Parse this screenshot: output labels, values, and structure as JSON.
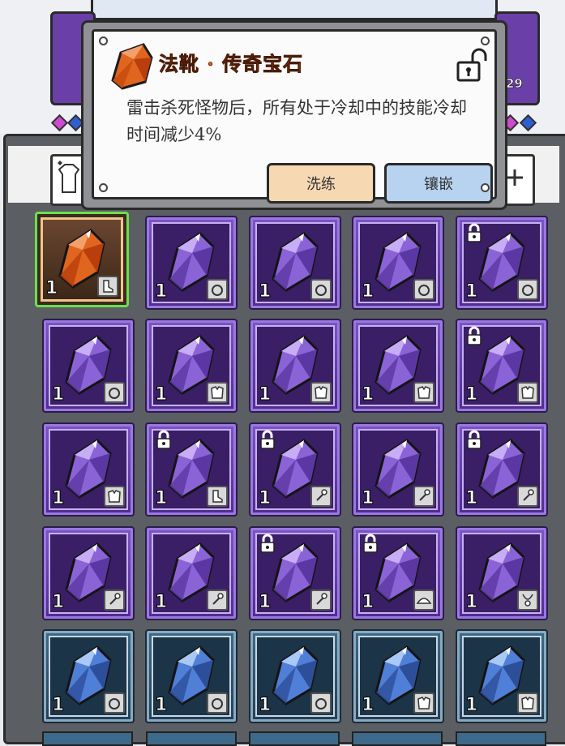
{
  "tooltip": {
    "title": "法靴 · 传奇宝石",
    "description": "雷击杀死怪物后，所有处于冷却中的技能冷却时间减少4%",
    "buttons": {
      "wash": "洗练",
      "inlay": "镶嵌"
    },
    "locked": false
  },
  "header": {
    "timer_fragment": ":29"
  },
  "colors": {
    "purple": "#6a3fa8",
    "blue": "#3d6a8a",
    "orange": "#e05a1a",
    "selected_outline": "#6ae04a"
  },
  "grid": {
    "rows": [
      [
        {
          "rarity": "orange",
          "count": "1",
          "slot": "boots-icon",
          "locked": false,
          "selected": true
        },
        {
          "rarity": "purple",
          "count": "1",
          "slot": "ring-icon",
          "locked": false
        },
        {
          "rarity": "purple",
          "count": "1",
          "slot": "ring-icon",
          "locked": false
        },
        {
          "rarity": "purple",
          "count": "1",
          "slot": "ring-icon",
          "locked": false
        },
        {
          "rarity": "purple",
          "count": "1",
          "slot": "ring-icon",
          "locked": true
        }
      ],
      [
        {
          "rarity": "purple",
          "count": "1",
          "slot": "ring-icon",
          "locked": false
        },
        {
          "rarity": "purple",
          "count": "1",
          "slot": "armor-icon",
          "locked": false
        },
        {
          "rarity": "purple",
          "count": "1",
          "slot": "armor-icon",
          "locked": false
        },
        {
          "rarity": "purple",
          "count": "1",
          "slot": "armor-icon",
          "locked": false
        },
        {
          "rarity": "purple",
          "count": "1",
          "slot": "armor-icon",
          "locked": true
        }
      ],
      [
        {
          "rarity": "purple",
          "count": "1",
          "slot": "armor-icon",
          "locked": false
        },
        {
          "rarity": "purple",
          "count": "1",
          "slot": "boots-icon",
          "locked": true
        },
        {
          "rarity": "purple",
          "count": "1",
          "slot": "staff-icon",
          "locked": true
        },
        {
          "rarity": "purple",
          "count": "1",
          "slot": "staff-icon",
          "locked": false
        },
        {
          "rarity": "purple",
          "count": "1",
          "slot": "staff-icon",
          "locked": true
        }
      ],
      [
        {
          "rarity": "purple",
          "count": "1",
          "slot": "staff-icon",
          "locked": false
        },
        {
          "rarity": "purple",
          "count": "1",
          "slot": "staff-icon",
          "locked": false
        },
        {
          "rarity": "purple",
          "count": "1",
          "slot": "staff-icon",
          "locked": true
        },
        {
          "rarity": "purple",
          "count": "1",
          "slot": "hat-icon",
          "locked": true
        },
        {
          "rarity": "purple",
          "count": "1",
          "slot": "necklace-icon",
          "locked": false
        }
      ],
      [
        {
          "rarity": "blue",
          "count": "1",
          "slot": "ring-icon",
          "locked": false
        },
        {
          "rarity": "blue",
          "count": "1",
          "slot": "ring-icon",
          "locked": false
        },
        {
          "rarity": "blue",
          "count": "1",
          "slot": "ring-icon",
          "locked": false
        },
        {
          "rarity": "blue",
          "count": "1",
          "slot": "armor-icon",
          "locked": false
        },
        {
          "rarity": "blue",
          "count": "1",
          "slot": "armor-icon",
          "locked": false
        }
      ]
    ]
  }
}
